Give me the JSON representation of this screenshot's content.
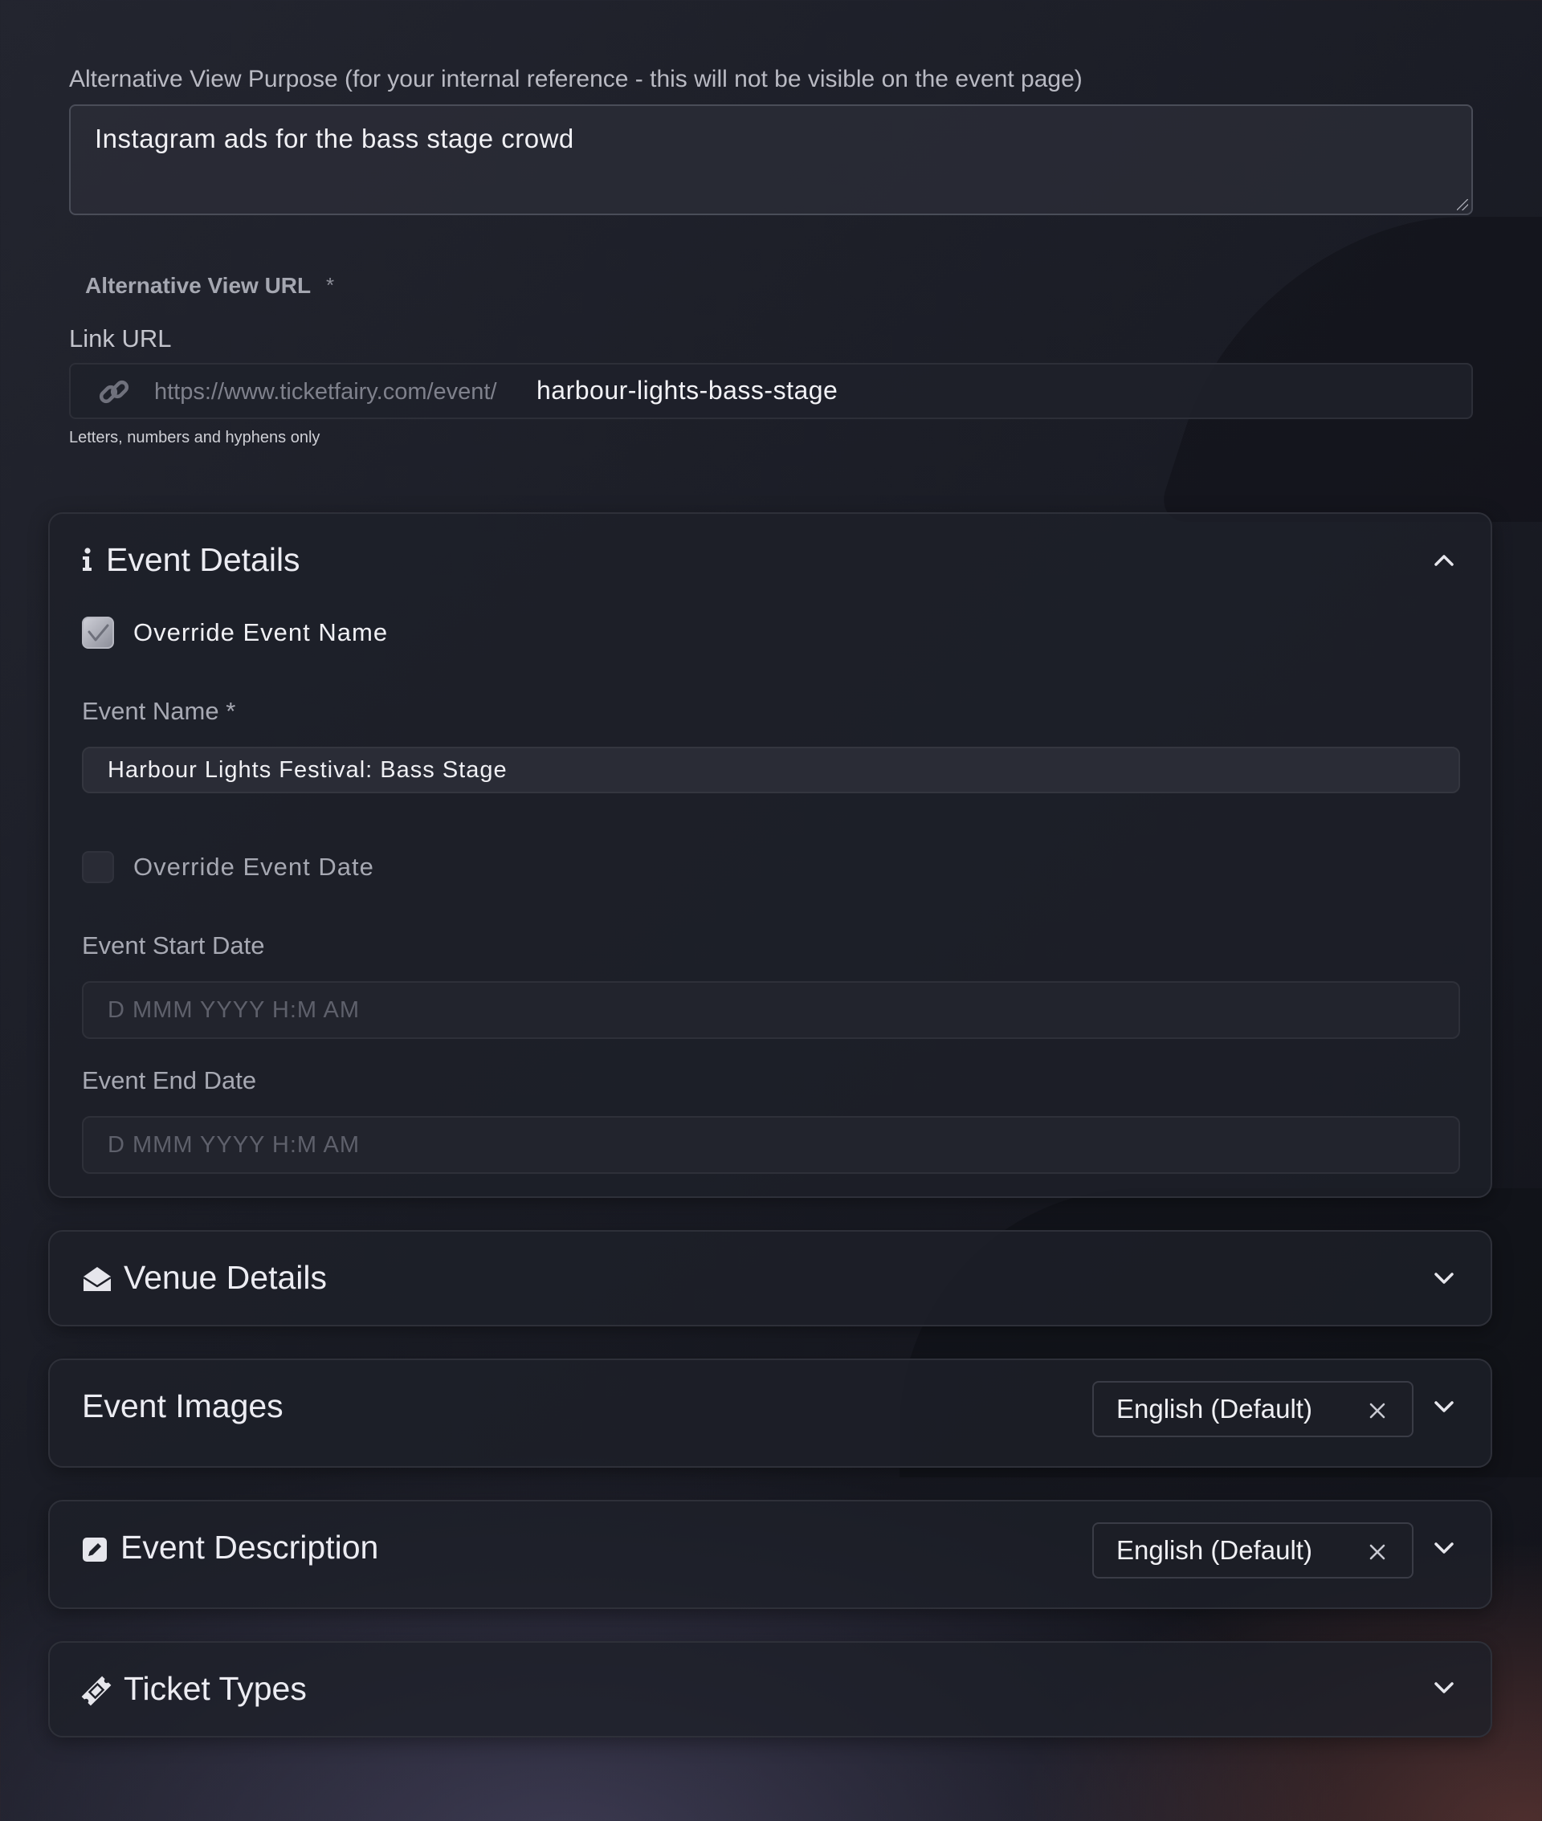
{
  "alt_view_purpose": {
    "label": "Alternative View Purpose (for your internal reference - this will not be visible on the event page)",
    "value": "Instagram ads for the bass stage crowd"
  },
  "alt_view_url": {
    "title": "Alternative View URL",
    "required_mark": "*",
    "link_label": "Link URL",
    "link_icon": "link-icon",
    "prefix": "https://www.ticketfairy.com/event/",
    "slug": "harbour-lights-bass-stage",
    "help": "Letters, numbers and hyphens only"
  },
  "event_details": {
    "title": "Event Details",
    "icon": "info-icon",
    "expanded": true,
    "override_name": {
      "label": "Override Event Name",
      "checked": true
    },
    "event_name": {
      "label": "Event Name *",
      "value": "Harbour Lights Festival: Bass Stage"
    },
    "override_date": {
      "label": "Override Event Date",
      "checked": false
    },
    "start_date": {
      "label": "Event Start Date",
      "placeholder": "D MMM YYYY H:M AM"
    },
    "end_date": {
      "label": "Event End Date",
      "placeholder": "D MMM YYYY H:M AM"
    }
  },
  "venue_details": {
    "title": "Venue Details",
    "icon": "venue-icon",
    "expanded": false
  },
  "event_images": {
    "title": "Event Images",
    "language": "English (Default)",
    "expanded": false
  },
  "event_description": {
    "title": "Event Description",
    "icon": "edit-icon",
    "language": "English (Default)",
    "expanded": false
  },
  "ticket_types": {
    "title": "Ticket Types",
    "icon": "ticket-icon",
    "expanded": false
  },
  "colors": {
    "text_primary": "#ececf2",
    "text_muted": "#a7a9b3",
    "placeholder": "#5e606b",
    "card_bg": "#1e2029",
    "input_bg": "#2a2c36"
  }
}
